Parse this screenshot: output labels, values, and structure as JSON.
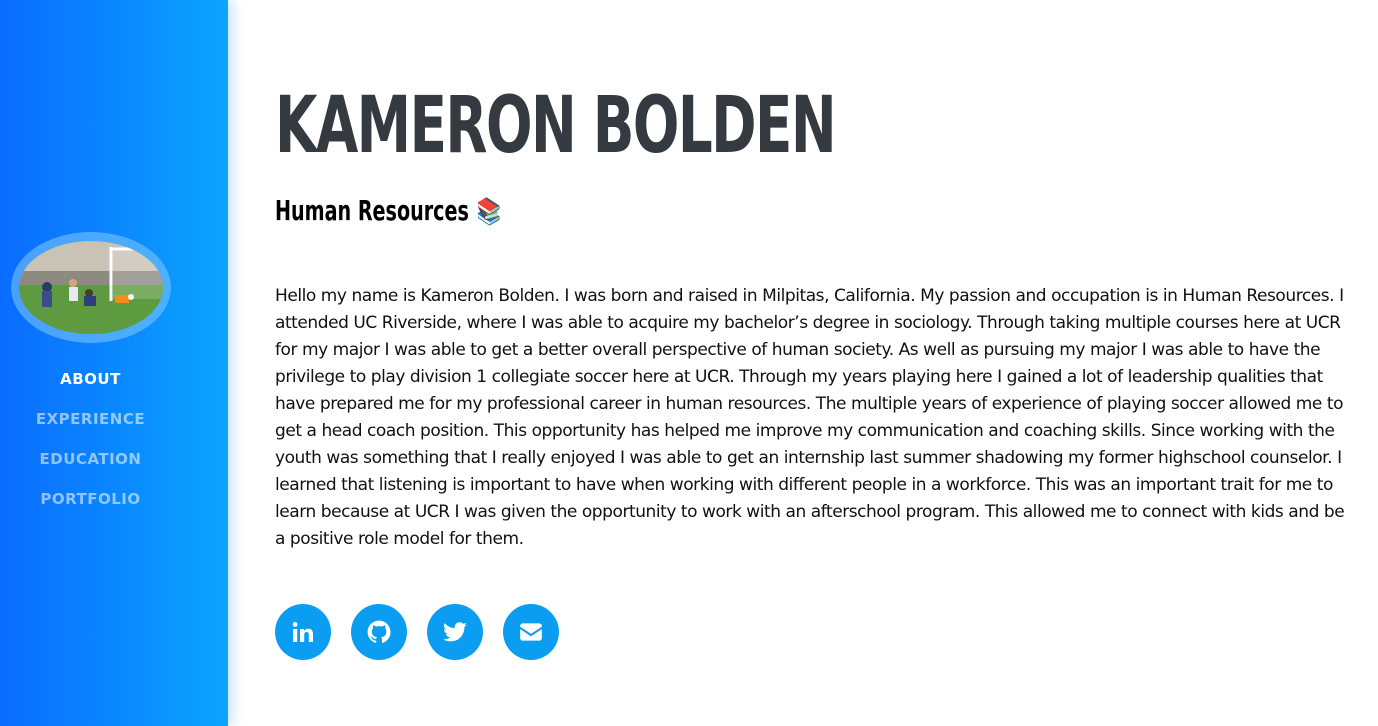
{
  "sidebar": {
    "avatar_alt": "profile photo",
    "nav": [
      {
        "label": "ABOUT",
        "active": true
      },
      {
        "label": "EXPERIENCE",
        "active": false
      },
      {
        "label": "EDUCATION",
        "active": false
      },
      {
        "label": "PORTFOLIO",
        "active": false
      }
    ]
  },
  "main": {
    "name": "KAMERON BOLDEN",
    "subtitle": "Human Resources",
    "subtitle_icon": "📚",
    "bio": "Hello my name is Kameron Bolden. I was born and raised in Milpitas, California. My passion and occupation is in Human Resources. I attended UC Riverside, where I was able to acquire my bachelor’s degree in sociology. Through taking multiple courses here at UCR for my major I was able to get a better overall perspective of human society. As well as pursuing my major I was able to have the privilege to play division 1 collegiate soccer here at UCR. Through my years playing here I gained a lot of leadership qualities that have prepared me for my professional career in human resources. The multiple years of experience of playing soccer allowed me to get a head coach position. This opportunity has helped me improve my communication and coaching skills. Since working with the youth was something that I really enjoyed I was able to get an internship last summer shadowing my former highschool counselor. I learned that listening is important to have when working with different people in a workforce. This was an important trait for me to learn because at UCR I was given the opportunity to work with an afterschool program. This allowed me to connect with kids and be a positive role model for them.",
    "social": [
      {
        "name": "linkedin-icon"
      },
      {
        "name": "github-icon"
      },
      {
        "name": "twitter-icon"
      },
      {
        "name": "envelope-icon"
      }
    ]
  },
  "colors": {
    "sidebar_gradient_start": "#0a6cff",
    "sidebar_gradient_end": "#0ba6ff",
    "heading": "#343a40",
    "social_button": "#0b9df2"
  }
}
